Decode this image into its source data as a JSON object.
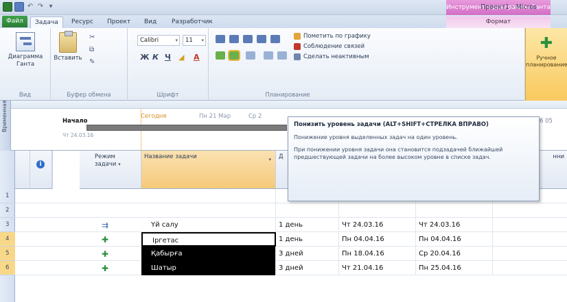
{
  "titlebar": {
    "context_title": "Инструменты диаграммы Ганта",
    "app_title": "Проект1 - Micros"
  },
  "tabs": {
    "file": "Файл",
    "task": "Задача",
    "resource": "Ресурс",
    "project": "Проект",
    "view": "Вид",
    "developer": "Разработчик",
    "format": "Формат"
  },
  "ribbon": {
    "view_group": {
      "button": "Диаграмма Ганта",
      "label": "Вид"
    },
    "clipboard_group": {
      "paste": "Вставить",
      "label": "Буфер обмена"
    },
    "font_group": {
      "font_name": "Calibri",
      "font_size": "11",
      "label": "Шрифт"
    },
    "schedule_group": {
      "mark_on_track": "Пометить по графику",
      "respect_links": "Соблюдение связей",
      "inactivate": "Сделать неактивным",
      "label": "Планирование"
    },
    "manual_schedule": "Ручное планирование"
  },
  "timeline": {
    "side_label": "Временная",
    "today": "Сегодня",
    "date1": "Пн 21 Мар",
    "date2": "Ср 2",
    "start_label": "Начало",
    "start_date": "Чт 24.03.16",
    "right_label": "6 05"
  },
  "grid": {
    "headers": {
      "mode": "Режим задачи",
      "name": "Название задачи",
      "duration": "Д",
      "extra": "нни"
    },
    "rows": [
      {
        "num": "1",
        "name": "",
        "duration": "",
        "start": "",
        "finish": "",
        "mode": ""
      },
      {
        "num": "2",
        "name": "",
        "duration": "",
        "start": "",
        "finish": "",
        "mode": ""
      },
      {
        "num": "3",
        "name": "Үй салу",
        "duration": "1 день",
        "start": "Чт 24.03.16",
        "finish": "Чт 24.03.16",
        "mode": "auto"
      },
      {
        "num": "4",
        "name": "Іргетас",
        "duration": "1 день",
        "start": "Пн 04.04.16",
        "finish": "Пн 04.04.16",
        "mode": "manual"
      },
      {
        "num": "5",
        "name": "Қабырға",
        "duration": "3 дней",
        "start": "Пн 18.04.16",
        "finish": "Ср 20.04.16",
        "mode": "manual"
      },
      {
        "num": "6",
        "name": "Шатыр",
        "duration": "3 дней",
        "start": "Чт 21.04.16",
        "finish": "Пн 25.04.16",
        "mode": "manual"
      }
    ]
  },
  "tooltip": {
    "title": "Понизить уровень задачи (ALT+SHIFT+СТРЕЛКА ВПРАВО)",
    "para1": "Понижение уровня выделенных задач на один уровень.",
    "para2": "При понижении уровня задачи она становится подзадачей ближайшей предшествующей задачи на более высоком уровне в списке задач."
  },
  "colors": {
    "file_tab": "#2b7d35",
    "manual_pin": "#2a8f3d",
    "selection": "#000000",
    "today": "#d28d1e"
  }
}
